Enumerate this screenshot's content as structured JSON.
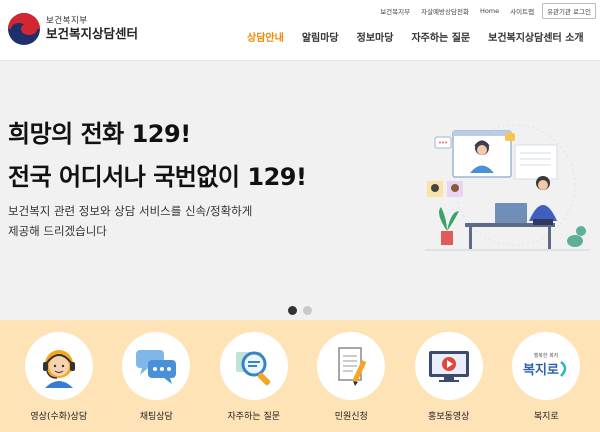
{
  "utility": {
    "links": [
      "보건복지부",
      "자살예방상담전화",
      "Home",
      "사이트맵"
    ],
    "login": "유관기관 로그인"
  },
  "logo": {
    "sub": "보건복지부",
    "main": "보건복지상담센터"
  },
  "nav": {
    "items": [
      "상담안내",
      "알림마당",
      "정보마당",
      "자주하는 질문",
      "보건복지상담센터 소개"
    ],
    "active_index": 0
  },
  "hero": {
    "line1": "희망의 전화 129!",
    "line2": "전국 어디서나 국번없이 129!",
    "desc1": "보건복지 관련 정보와 상담 서비스를 신속/정확하게",
    "desc2": "제공해 드리겠습니다",
    "slides": 2,
    "active_slide": 1
  },
  "services": [
    {
      "label": "영상(수화)상담",
      "icon": "headset-agent-icon"
    },
    {
      "label": "채팅상담",
      "icon": "chat-bubble-icon"
    },
    {
      "label": "자주하는 질문",
      "icon": "magnifier-icon"
    },
    {
      "label": "민원신청",
      "icon": "document-pen-icon"
    },
    {
      "label": "홍보동영상",
      "icon": "video-player-icon"
    },
    {
      "label": "복지로",
      "icon": "bokjiro-logo-icon",
      "logo_text": "복지로",
      "logo_caption": "행복한 복지"
    }
  ],
  "colors": {
    "accent": "#f08a00",
    "service_band": "#fde3b6",
    "hero_bg": "#f1f1f1"
  }
}
